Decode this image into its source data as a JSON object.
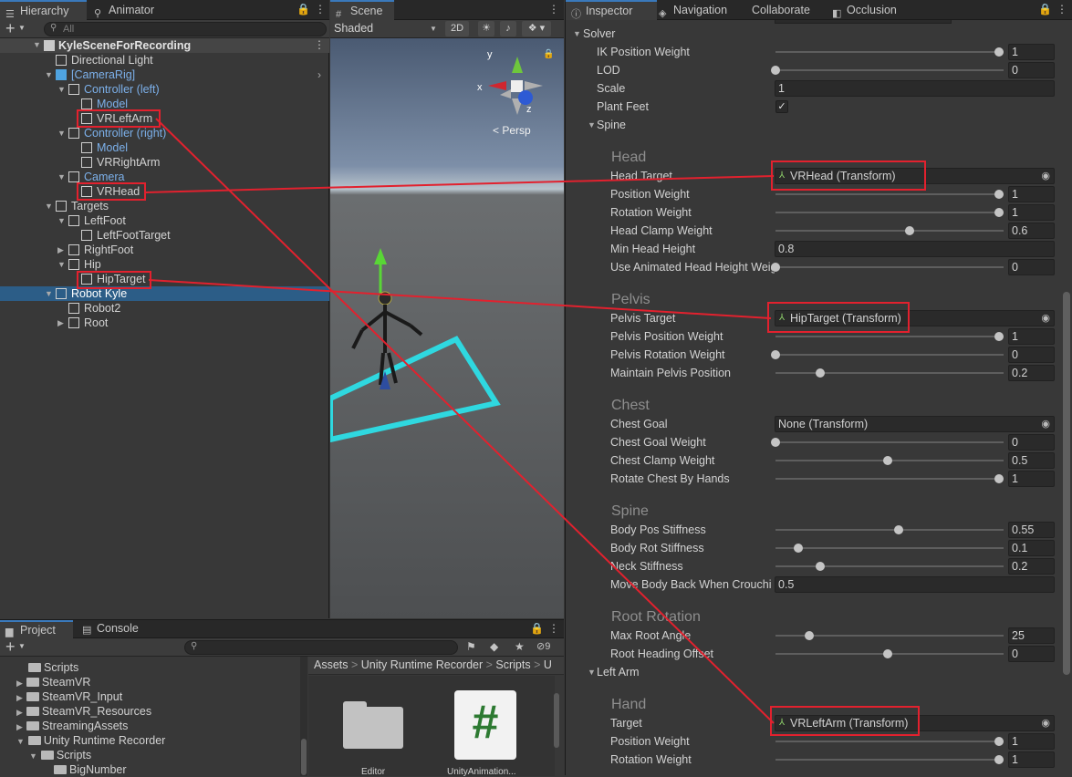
{
  "hierarchy": {
    "tabs": [
      "Hierarchy",
      "Animator"
    ],
    "search_placeholder": "All",
    "scene_name": "KyleSceneForRecording",
    "items": [
      {
        "label": "Directional Light"
      },
      {
        "label": "[CameraRig]"
      },
      {
        "label": "Controller (left)"
      },
      {
        "label": "Model"
      },
      {
        "label": "VRLeftArm"
      },
      {
        "label": "Controller (right)"
      },
      {
        "label": "Model"
      },
      {
        "label": "VRRightArm"
      },
      {
        "label": "Camera"
      },
      {
        "label": "VRHead"
      },
      {
        "label": "Targets"
      },
      {
        "label": "LeftFoot"
      },
      {
        "label": "LeftFootTarget"
      },
      {
        "label": "RightFoot"
      },
      {
        "label": "Hip"
      },
      {
        "label": "HipTarget"
      },
      {
        "label": "Robot Kyle"
      },
      {
        "label": "Robot2"
      },
      {
        "label": "Root"
      }
    ]
  },
  "scene": {
    "tab": "Scene",
    "shading": "Shaded",
    "mode_2d": "2D",
    "persp": "< Persp",
    "axes": {
      "x": "x",
      "y": "y",
      "z": "z"
    }
  },
  "inspector": {
    "tabs": [
      "Inspector",
      "Navigation",
      "Collaborate",
      "Occlusion"
    ],
    "solver_label": "Solver",
    "rows": {
      "ik_pos_weight": {
        "label": "IK Position Weight",
        "value": "1",
        "fraction": 1.0
      },
      "lod": {
        "label": "LOD",
        "value": "0",
        "fraction": 0.0
      },
      "scale": {
        "label": "Scale",
        "value": "1"
      },
      "plant_feet": {
        "label": "Plant Feet"
      },
      "spine_fold": {
        "label": "Spine"
      },
      "head_header": "Head",
      "head_target": {
        "label": "Head Target",
        "value": "VRHead (Transform)"
      },
      "head_pos_weight": {
        "label": "Position Weight",
        "value": "1",
        "fraction": 1.0
      },
      "head_rot_weight": {
        "label": "Rotation Weight",
        "value": "1",
        "fraction": 1.0
      },
      "head_clamp": {
        "label": "Head Clamp Weight",
        "value": "0.6",
        "fraction": 0.6
      },
      "min_head_height": {
        "label": "Min Head Height",
        "value": "0.8"
      },
      "use_anim_head": {
        "label": "Use Animated Head Height Weig",
        "value": "0",
        "fraction": 0.0
      },
      "pelvis_header": "Pelvis",
      "pelvis_target": {
        "label": "Pelvis Target",
        "value": "HipTarget (Transform)"
      },
      "pelvis_pos_weight": {
        "label": "Pelvis Position Weight",
        "value": "1",
        "fraction": 1.0
      },
      "pelvis_rot_weight": {
        "label": "Pelvis Rotation Weight",
        "value": "0",
        "fraction": 0.0
      },
      "maintain_pelvis": {
        "label": "Maintain Pelvis Position",
        "value": "0.2",
        "fraction": 0.2
      },
      "chest_header": "Chest",
      "chest_goal": {
        "label": "Chest Goal",
        "value": "None (Transform)"
      },
      "chest_goal_weight": {
        "label": "Chest Goal Weight",
        "value": "0",
        "fraction": 0.0
      },
      "chest_clamp": {
        "label": "Chest Clamp Weight",
        "value": "0.5",
        "fraction": 0.5
      },
      "rotate_chest": {
        "label": "Rotate Chest By Hands",
        "value": "1",
        "fraction": 1.0
      },
      "spine_header": "Spine",
      "body_pos_stiff": {
        "label": "Body Pos Stiffness",
        "value": "0.55",
        "fraction": 0.55
      },
      "body_rot_stiff": {
        "label": "Body Rot Stiffness",
        "value": "0.1",
        "fraction": 0.1
      },
      "neck_stiff": {
        "label": "Neck Stiffness",
        "value": "0.2",
        "fraction": 0.2
      },
      "move_body_back": {
        "label": "Move Body Back When Crouchi",
        "value": "0.5"
      },
      "root_rot_header": "Root Rotation",
      "max_root_angle": {
        "label": "Max Root Angle",
        "value": "25",
        "fraction": 0.15
      },
      "root_heading": {
        "label": "Root Heading Offset",
        "value": "0",
        "fraction": 0.5
      },
      "left_arm_fold": {
        "label": "Left Arm"
      },
      "hand_header": "Hand",
      "hand_target": {
        "label": "Target",
        "value": "VRLeftArm (Transform)"
      },
      "hand_pos_weight": {
        "label": "Position Weight",
        "value": "1",
        "fraction": 1.0
      },
      "hand_rot_weight": {
        "label": "Rotation Weight",
        "value": "1",
        "fraction": 1.0
      }
    }
  },
  "project": {
    "tabs": [
      "Project",
      "Console"
    ],
    "hidden_count": "9",
    "tree": [
      "Scripts",
      "SteamVR",
      "SteamVR_Input",
      "SteamVR_Resources",
      "StreamingAssets",
      "Unity Runtime Recorder",
      "Scripts",
      "BigNumber"
    ],
    "breadcrumb": [
      "Assets",
      "Unity Runtime Recorder",
      "Scripts",
      "U"
    ],
    "assets": [
      {
        "label": "Editor"
      },
      {
        "label": "UnityAnimation..."
      }
    ]
  },
  "colors": {
    "annotation": "#e2212e",
    "selection": "#2c5d87",
    "prefab": "#7cb0ea",
    "accent": "#3a79bb"
  }
}
